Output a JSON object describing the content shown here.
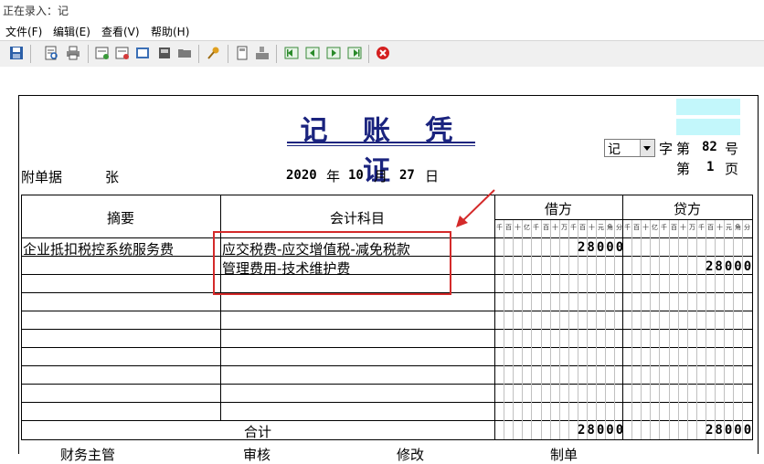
{
  "status": "正在录入：记",
  "menu": [
    "文件(F)",
    "编辑(E)",
    "查看(V)",
    "帮助(H)"
  ],
  "toolbar_icons": [
    "save-icon",
    "print-preview-icon",
    "print-icon",
    "add-icon",
    "edit-icon",
    "book-icon",
    "printer2-icon",
    "folder-icon",
    "key-icon",
    "calculator-icon",
    "flow-icon",
    "first-icon",
    "prev-icon",
    "next-icon",
    "last-icon",
    "close-icon"
  ],
  "voucher": {
    "title": "记 账 凭 证",
    "type": "记",
    "zi_label": "字",
    "di_label": "第",
    "number": "82",
    "hao_label": "号",
    "page_di": "第",
    "page": "1",
    "page_label": "页",
    "attach_label": "附单据",
    "attach_unit": "张",
    "year": "2020",
    "year_label": "年",
    "month": "10",
    "month_label": "月",
    "day": "27",
    "day_label": "日"
  },
  "table": {
    "col_summary": "摘要",
    "col_account": "会计科目",
    "col_debit": "借方",
    "col_credit": "贷方",
    "digit_heads": [
      "千",
      "百",
      "十",
      "亿",
      "千",
      "百",
      "十",
      "万",
      "千",
      "百",
      "十",
      "元",
      "角",
      "分"
    ],
    "rows": [
      {
        "summary": "企业抵扣税控系统服务费",
        "account": "应交税费-应交增值税-减免税款",
        "debit": "28000",
        "credit": ""
      },
      {
        "summary": "",
        "account": "管理费用-技术维护费",
        "debit": "",
        "credit": "28000"
      }
    ],
    "total_label": "合计",
    "total_debit": "28000",
    "total_credit": "28000"
  },
  "footer": [
    "财务主管",
    "审核",
    "修改",
    "制单"
  ],
  "colors": {
    "title": "#1a237e",
    "highlight": "#d42a2a",
    "cyan": "#c3f7fb"
  }
}
